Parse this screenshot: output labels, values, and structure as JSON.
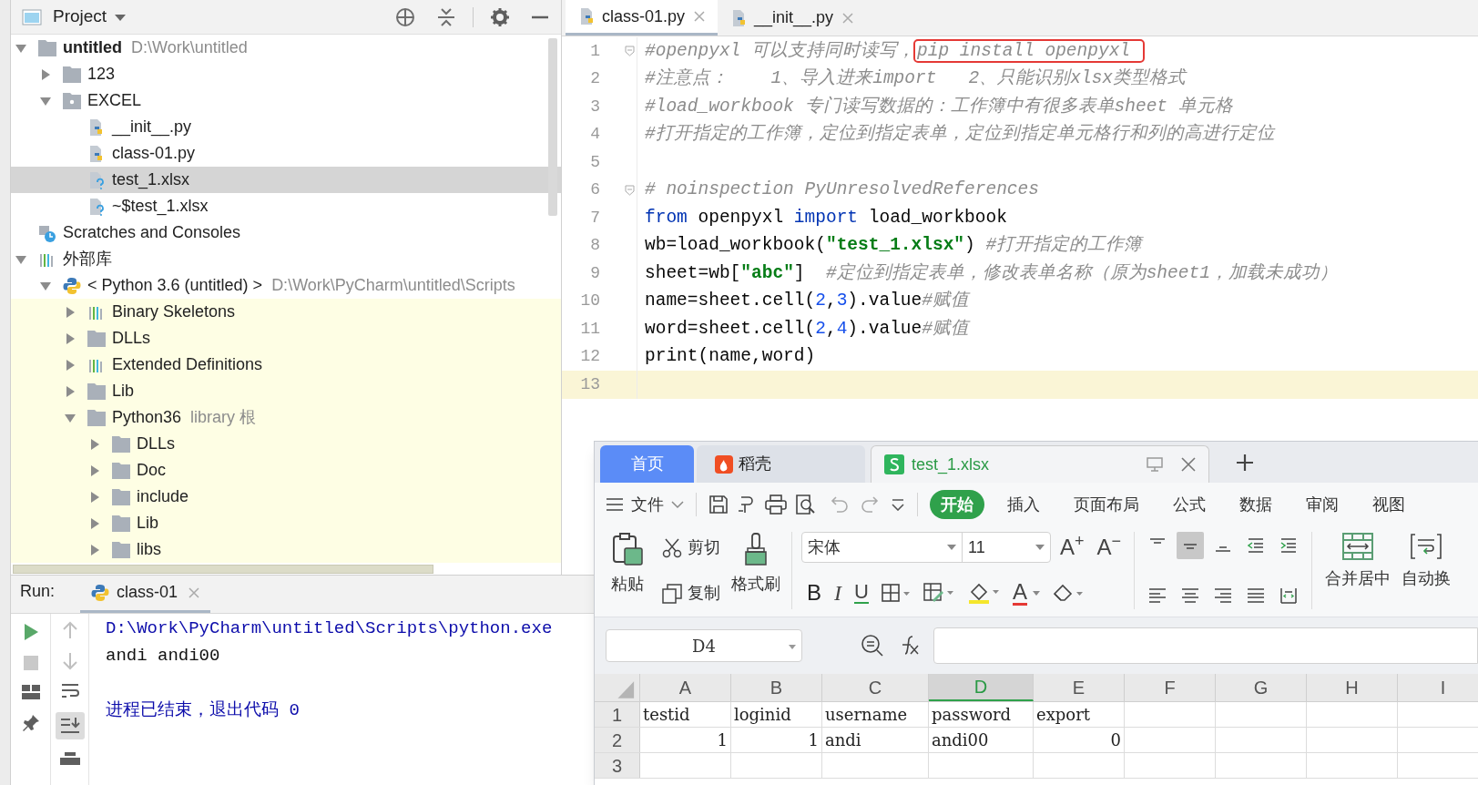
{
  "project": {
    "title": "Project",
    "tree": [
      {
        "label": "untitled",
        "hint": "D:\\Work\\untitled",
        "kind": "folder",
        "bold": true,
        "expanded": true,
        "selected": false,
        "children": [
          {
            "label": "123",
            "kind": "folder",
            "expanded": false,
            "selected": false
          },
          {
            "label": "EXCEL",
            "kind": "package",
            "expanded": true,
            "selected": false,
            "children": [
              {
                "label": "__init__.py",
                "kind": "python_file",
                "selected": false
              },
              {
                "label": "class-01.py",
                "kind": "python_file",
                "selected": false
              },
              {
                "label": "test_1.xlsx",
                "kind": "unknown_file",
                "selected": true
              },
              {
                "label": "~$test_1.xlsx",
                "kind": "unknown_file",
                "selected": false
              }
            ]
          }
        ]
      },
      {
        "label": "Scratches and Consoles",
        "kind": "scratches",
        "selected": false
      },
      {
        "label": "外部库",
        "kind": "library",
        "expanded": true,
        "selected": false,
        "children": [
          {
            "label": "< Python 3.6 (untitled) >",
            "hint": "D:\\Work\\PyCharm\\untitled\\Scripts",
            "kind": "python",
            "expanded": true,
            "selected": false,
            "children": [
              {
                "label": "Binary Skeletons",
                "kind": "library",
                "expanded": false,
                "selected": false
              },
              {
                "label": "DLLs",
                "kind": "folder",
                "expanded": false,
                "selected": false
              },
              {
                "label": "Extended Definitions",
                "kind": "library",
                "expanded": false,
                "selected": false
              },
              {
                "label": "Lib",
                "kind": "folder",
                "expanded": false,
                "selected": false
              },
              {
                "label": "Python36",
                "hint": "library 根",
                "kind": "folder",
                "expanded": true,
                "selected": false,
                "children": [
                  {
                    "label": "DLLs",
                    "kind": "folder",
                    "expanded": false,
                    "selected": false
                  },
                  {
                    "label": "Doc",
                    "kind": "folder",
                    "expanded": false,
                    "selected": false
                  },
                  {
                    "label": "include",
                    "kind": "folder",
                    "expanded": false,
                    "selected": false
                  },
                  {
                    "label": "Lib",
                    "kind": "folder",
                    "expanded": false,
                    "selected": false
                  },
                  {
                    "label": "libs",
                    "kind": "folder",
                    "expanded": false,
                    "selected": false
                  }
                ]
              }
            ]
          }
        ]
      }
    ]
  },
  "editor": {
    "tabs": [
      {
        "label": "class-01.py",
        "selected": true
      },
      {
        "label": "__init__.py",
        "selected": false
      }
    ],
    "lines": [
      {
        "number": "1",
        "fold": true,
        "current": false,
        "tokens": [
          {
            "text": "#openpyxl 可以支持同时读写，",
            "kind": "comment"
          },
          {
            "text": "pip install openpyxl ",
            "kind": "boxed"
          }
        ]
      },
      {
        "number": "2",
        "fold": false,
        "current": false,
        "tokens": [
          {
            "text": "#注意点：    1、导入进来import   2、只能识别xlsx类型格式",
            "kind": "comment"
          }
        ]
      },
      {
        "number": "3",
        "fold": false,
        "current": false,
        "tokens": [
          {
            "text": "#load_workbook 专门读写数据的：工作簿中有很多表单sheet 单元格",
            "kind": "comment"
          }
        ]
      },
      {
        "number": "4",
        "fold": false,
        "current": false,
        "tokens": [
          {
            "text": "#打开指定的工作簿，定位到指定表单，定位到指定单元格行和列的高进行定位",
            "kind": "comment"
          }
        ]
      },
      {
        "number": "5",
        "fold": false,
        "current": false
      },
      {
        "number": "6",
        "fold": true,
        "current": false,
        "tokens": [
          {
            "text": "# noinspection PyUnresolvedReferences",
            "kind": "comment"
          }
        ]
      },
      {
        "number": "7",
        "fold": false,
        "current": false,
        "tokens": [
          {
            "text": "from",
            "kind": "keyword"
          },
          {
            "text": " openpyxl ",
            "kind": "plain"
          },
          {
            "text": "import",
            "kind": "keyword"
          },
          {
            "text": " load_workbook",
            "kind": "plain"
          }
        ]
      },
      {
        "number": "8",
        "fold": false,
        "current": false,
        "tokens": [
          {
            "text": "wb=load_workbook(",
            "kind": "plain"
          },
          {
            "text": "\"test_1.xlsx\"",
            "kind": "string"
          },
          {
            "text": ") ",
            "kind": "plain"
          },
          {
            "text": "#打开指定的工作簿",
            "kind": "comment"
          }
        ]
      },
      {
        "number": "9",
        "fold": false,
        "current": false,
        "tokens": [
          {
            "text": "sheet=wb[",
            "kind": "plain"
          },
          {
            "text": "\"abc\"",
            "kind": "string"
          },
          {
            "text": "]  ",
            "kind": "plain"
          },
          {
            "text": "#定位到指定表单，修改表单名称（原为sheet1，加载未成功）",
            "kind": "comment"
          }
        ]
      },
      {
        "number": "10",
        "fold": false,
        "current": false,
        "tokens": [
          {
            "text": "name=sheet.cell(",
            "kind": "plain"
          },
          {
            "text": "2",
            "kind": "number"
          },
          {
            "text": ",",
            "kind": "plain"
          },
          {
            "text": "3",
            "kind": "number"
          },
          {
            "text": ").value",
            "kind": "plain"
          },
          {
            "text": "#赋值",
            "kind": "comment"
          }
        ]
      },
      {
        "number": "11",
        "fold": false,
        "current": false,
        "tokens": [
          {
            "text": "word=sheet.cell(",
            "kind": "plain"
          },
          {
            "text": "2",
            "kind": "number"
          },
          {
            "text": ",",
            "kind": "plain"
          },
          {
            "text": "4",
            "kind": "number"
          },
          {
            "text": ").value",
            "kind": "plain"
          },
          {
            "text": "#赋值",
            "kind": "comment"
          }
        ]
      },
      {
        "number": "12",
        "fold": false,
        "current": false,
        "tokens": [
          {
            "text": "print(name,word)",
            "kind": "plain"
          }
        ]
      },
      {
        "number": "13",
        "fold": false,
        "current": true
      }
    ]
  },
  "run": {
    "title": "Run:",
    "tab": "class-01",
    "output": [
      {
        "text": "D:\\Work\\PyCharm\\untitled\\Scripts\\python.exe",
        "kind": "command"
      },
      {
        "text": "andi andi00",
        "kind": "output"
      },
      {
        "text": "进程已结束，退出代码 0",
        "kind": "exit"
      }
    ]
  },
  "wps": {
    "tabs": [
      {
        "label": "首页",
        "kind": "home",
        "selected": false
      },
      {
        "label": "稻壳",
        "kind": "docer",
        "selected": false
      },
      {
        "label": "test_1.xlsx",
        "kind": "file",
        "selected": true
      }
    ],
    "file_menu": "文件",
    "menu_tabs": [
      {
        "label": "开始",
        "selected": true
      },
      {
        "label": "插入",
        "selected": false
      },
      {
        "label": "页面布局",
        "selected": false
      },
      {
        "label": "公式",
        "selected": false
      },
      {
        "label": "数据",
        "selected": false
      },
      {
        "label": "审阅",
        "selected": false
      },
      {
        "label": "视图",
        "selected": false
      }
    ],
    "ribbon": {
      "paste": "粘贴",
      "cut": "剪切",
      "copy": "复制",
      "format_painter": "格式刷",
      "font_name": "宋体",
      "font_size": "11",
      "grow_font": "A$^{+}$",
      "shrink_font": "A$^{−}$",
      "bold": "B",
      "italic": "I",
      "underline": "U",
      "font_color": "A",
      "align_buttons": [
        {
          "kind": "top",
          "selected": false
        },
        {
          "kind": "middle",
          "selected": true
        },
        {
          "kind": "bottom",
          "selected": false
        },
        {
          "kind": "outdent",
          "selected": false
        },
        {
          "kind": "indent",
          "selected": false
        },
        {
          "kind": "left",
          "selected": false
        },
        {
          "kind": "center",
          "selected": false
        },
        {
          "kind": "right",
          "selected": false
        },
        {
          "kind": "justify",
          "selected": false
        },
        {
          "kind": "distributed",
          "selected": false
        }
      ],
      "merge": "合并居中",
      "wrap": "自动换"
    },
    "name_box": "D4",
    "columns": [
      {
        "label": "A",
        "selected": false
      },
      {
        "label": "B",
        "selected": false
      },
      {
        "label": "C",
        "selected": false
      },
      {
        "label": "D",
        "selected": true
      },
      {
        "label": "E",
        "selected": false
      },
      {
        "label": "F",
        "selected": false
      },
      {
        "label": "G",
        "selected": false
      },
      {
        "label": "H",
        "selected": false
      },
      {
        "label": "I",
        "selected": false
      }
    ],
    "rows": [
      {
        "number": "1",
        "cells": [
          {
            "text": "testid",
            "kind": "text"
          },
          {
            "text": "loginid",
            "kind": "text"
          },
          {
            "text": "username",
            "kind": "text"
          },
          {
            "text": "password",
            "kind": "text"
          },
          {
            "text": "export",
            "kind": "text"
          }
        ]
      },
      {
        "number": "2",
        "cells": [
          {
            "text": "1",
            "kind": "number"
          },
          {
            "text": "1",
            "kind": "number"
          },
          {
            "text": "andi",
            "kind": "text"
          },
          {
            "text": "andi00",
            "kind": "text"
          },
          {
            "text": "0",
            "kind": "number"
          }
        ]
      },
      {
        "number": "3"
      }
    ]
  }
}
